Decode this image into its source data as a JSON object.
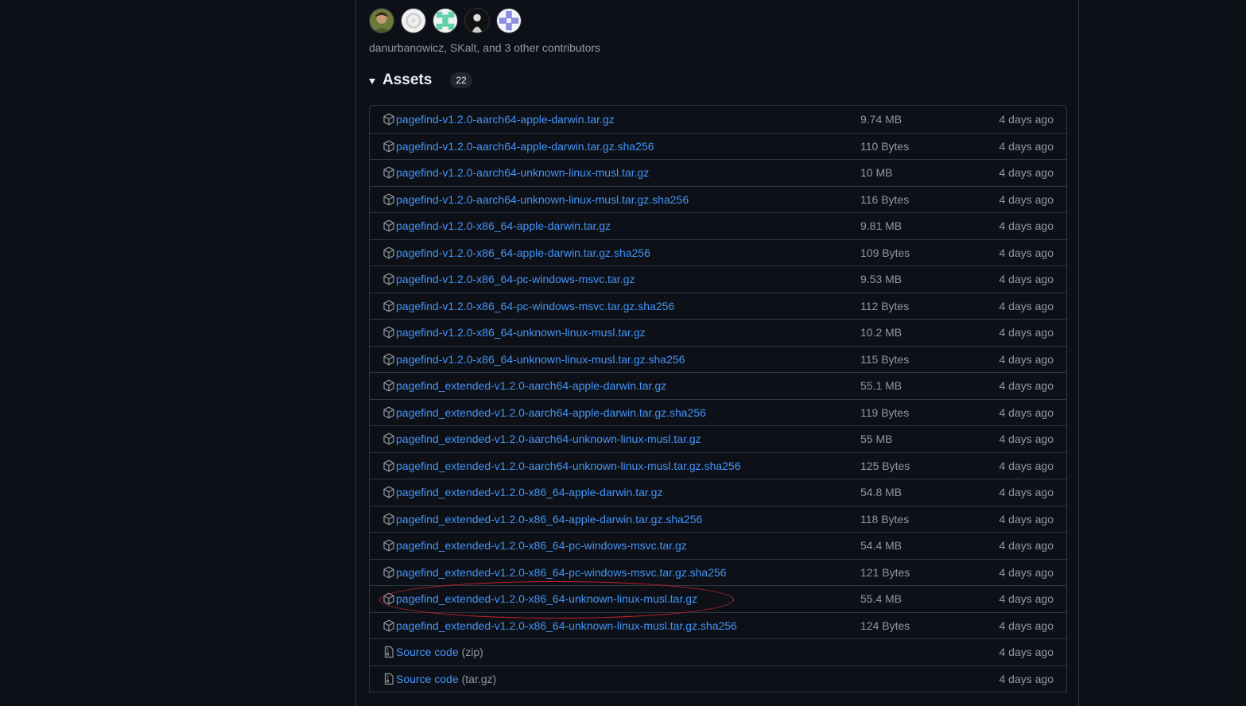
{
  "contributors": {
    "avatars": [
      "contributor-avatar-1",
      "contributor-avatar-2",
      "contributor-avatar-3",
      "contributor-avatar-4",
      "contributor-avatar-5"
    ],
    "text": "danurbanowicz, SKalt, and 3 other contributors"
  },
  "assets": {
    "title": "Assets",
    "count": "22",
    "items": [
      {
        "name": "pagefind-v1.2.0-aarch64-apple-darwin.tar.gz",
        "size": "9.74 MB",
        "date": "4 days ago",
        "icon": "package-icon"
      },
      {
        "name": "pagefind-v1.2.0-aarch64-apple-darwin.tar.gz.sha256",
        "size": "110 Bytes",
        "date": "4 days ago",
        "icon": "package-icon"
      },
      {
        "name": "pagefind-v1.2.0-aarch64-unknown-linux-musl.tar.gz",
        "size": "10 MB",
        "date": "4 days ago",
        "icon": "package-icon"
      },
      {
        "name": "pagefind-v1.2.0-aarch64-unknown-linux-musl.tar.gz.sha256",
        "size": "116 Bytes",
        "date": "4 days ago",
        "icon": "package-icon"
      },
      {
        "name": "pagefind-v1.2.0-x86_64-apple-darwin.tar.gz",
        "size": "9.81 MB",
        "date": "4 days ago",
        "icon": "package-icon"
      },
      {
        "name": "pagefind-v1.2.0-x86_64-apple-darwin.tar.gz.sha256",
        "size": "109 Bytes",
        "date": "4 days ago",
        "icon": "package-icon"
      },
      {
        "name": "pagefind-v1.2.0-x86_64-pc-windows-msvc.tar.gz",
        "size": "9.53 MB",
        "date": "4 days ago",
        "icon": "package-icon"
      },
      {
        "name": "pagefind-v1.2.0-x86_64-pc-windows-msvc.tar.gz.sha256",
        "size": "112 Bytes",
        "date": "4 days ago",
        "icon": "package-icon"
      },
      {
        "name": "pagefind-v1.2.0-x86_64-unknown-linux-musl.tar.gz",
        "size": "10.2 MB",
        "date": "4 days ago",
        "icon": "package-icon"
      },
      {
        "name": "pagefind-v1.2.0-x86_64-unknown-linux-musl.tar.gz.sha256",
        "size": "115 Bytes",
        "date": "4 days ago",
        "icon": "package-icon"
      },
      {
        "name": "pagefind_extended-v1.2.0-aarch64-apple-darwin.tar.gz",
        "size": "55.1 MB",
        "date": "4 days ago",
        "icon": "package-icon"
      },
      {
        "name": "pagefind_extended-v1.2.0-aarch64-apple-darwin.tar.gz.sha256",
        "size": "119 Bytes",
        "date": "4 days ago",
        "icon": "package-icon"
      },
      {
        "name": "pagefind_extended-v1.2.0-aarch64-unknown-linux-musl.tar.gz",
        "size": "55 MB",
        "date": "4 days ago",
        "icon": "package-icon"
      },
      {
        "name": "pagefind_extended-v1.2.0-aarch64-unknown-linux-musl.tar.gz.sha256",
        "size": "125 Bytes",
        "date": "4 days ago",
        "icon": "package-icon"
      },
      {
        "name": "pagefind_extended-v1.2.0-x86_64-apple-darwin.tar.gz",
        "size": "54.8 MB",
        "date": "4 days ago",
        "icon": "package-icon"
      },
      {
        "name": "pagefind_extended-v1.2.0-x86_64-apple-darwin.tar.gz.sha256",
        "size": "118 Bytes",
        "date": "4 days ago",
        "icon": "package-icon"
      },
      {
        "name": "pagefind_extended-v1.2.0-x86_64-pc-windows-msvc.tar.gz",
        "size": "54.4 MB",
        "date": "4 days ago",
        "icon": "package-icon"
      },
      {
        "name": "pagefind_extended-v1.2.0-x86_64-pc-windows-msvc.tar.gz.sha256",
        "size": "121 Bytes",
        "date": "4 days ago",
        "icon": "package-icon"
      },
      {
        "name": "pagefind_extended-v1.2.0-x86_64-unknown-linux-musl.tar.gz",
        "size": "55.4 MB",
        "date": "4 days ago",
        "icon": "package-icon"
      },
      {
        "name": "pagefind_extended-v1.2.0-x86_64-unknown-linux-musl.tar.gz.sha256",
        "size": "124 Bytes",
        "date": "4 days ago",
        "icon": "package-icon"
      },
      {
        "name": "Source code",
        "sub": "(zip)",
        "size": "",
        "date": "4 days ago",
        "icon": "file-zip-icon"
      },
      {
        "name": "Source code",
        "sub": "(tar.gz)",
        "size": "",
        "date": "4 days ago",
        "icon": "file-zip-icon"
      }
    ]
  },
  "colors": {
    "background": "#0d1117",
    "link": "#4493f8",
    "muted": "#9198a1",
    "border": "#30363d",
    "annotation": "#c8202c"
  }
}
